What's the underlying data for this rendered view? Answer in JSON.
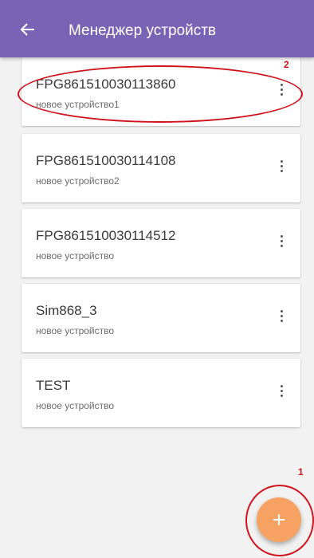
{
  "appbar": {
    "back_icon": "arrow-left-icon",
    "title": "Менеджер устройств",
    "color": "#7a63b5"
  },
  "devices": [
    {
      "name": "FPG861510030113860",
      "description": "новое устройство1"
    },
    {
      "name": "FPG861510030114108",
      "description": "новое устройство2"
    },
    {
      "name": "FPG861510030114512",
      "description": "новое устройство"
    },
    {
      "name": "Sim868_3",
      "description": "новое устройство"
    },
    {
      "name": "TEST",
      "description": "новое устройство"
    }
  ],
  "card_menu_icon": "more-vert-icon",
  "fab": {
    "icon": "plus-icon",
    "color": "#f5a262"
  },
  "annotations": [
    {
      "label": "1",
      "color": "#d0141c"
    },
    {
      "label": "2",
      "color": "#d0141c"
    }
  ]
}
